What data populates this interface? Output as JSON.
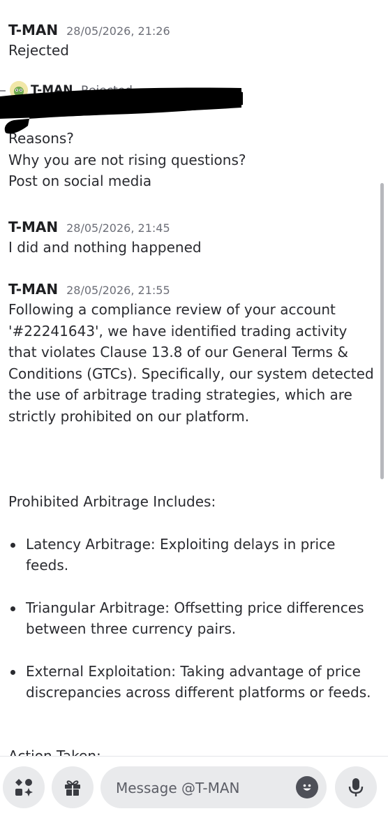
{
  "chat": {
    "messages": [
      {
        "author": "T-MAN",
        "time": "28/05/2026, 21:26",
        "lines": [
          "Rejected"
        ]
      },
      {
        "reply_author": "T-MAN",
        "reply_text": "Rejected",
        "lines": [
          "Reasons?",
          "Why you are not rising questions?",
          "Post on social media"
        ]
      },
      {
        "author": "T-MAN",
        "time": "28/05/2026, 21:45",
        "lines": [
          "I did and nothing happened"
        ]
      },
      {
        "author": "T-MAN",
        "time": "28/05/2026, 21:55",
        "body": "Following a compliance review of your account '#22241643', we have identified trading activity that violates Clause 13.8 of our General Terms & Conditions (GTCs). Specifically, our system detected the use of arbitrage trading strategies, which are strictly prohibited on our platform.",
        "list_heading": "Prohibited Arbitrage Includes:",
        "bullets": [
          "Latency Arbitrage: Exploiting delays in price feeds.",
          "Triangular Arbitrage: Offsetting price differences between three currency pairs.",
          "External Exploitation: Taking advantage of price discrepancies across different platforms or feeds."
        ],
        "cut_heading": "Action Taken:"
      }
    ]
  },
  "composer": {
    "placeholder": "Message @T-MAN"
  },
  "icons": {
    "apps": "apps-icon",
    "gift": "gift-icon",
    "emoji": "emoji-icon",
    "mic": "microphone-icon"
  },
  "colors": {
    "background": "#ffffff",
    "text": "#2a2b30",
    "timestamp": "#6d6f78",
    "composer_bg": "#e9eaec"
  }
}
